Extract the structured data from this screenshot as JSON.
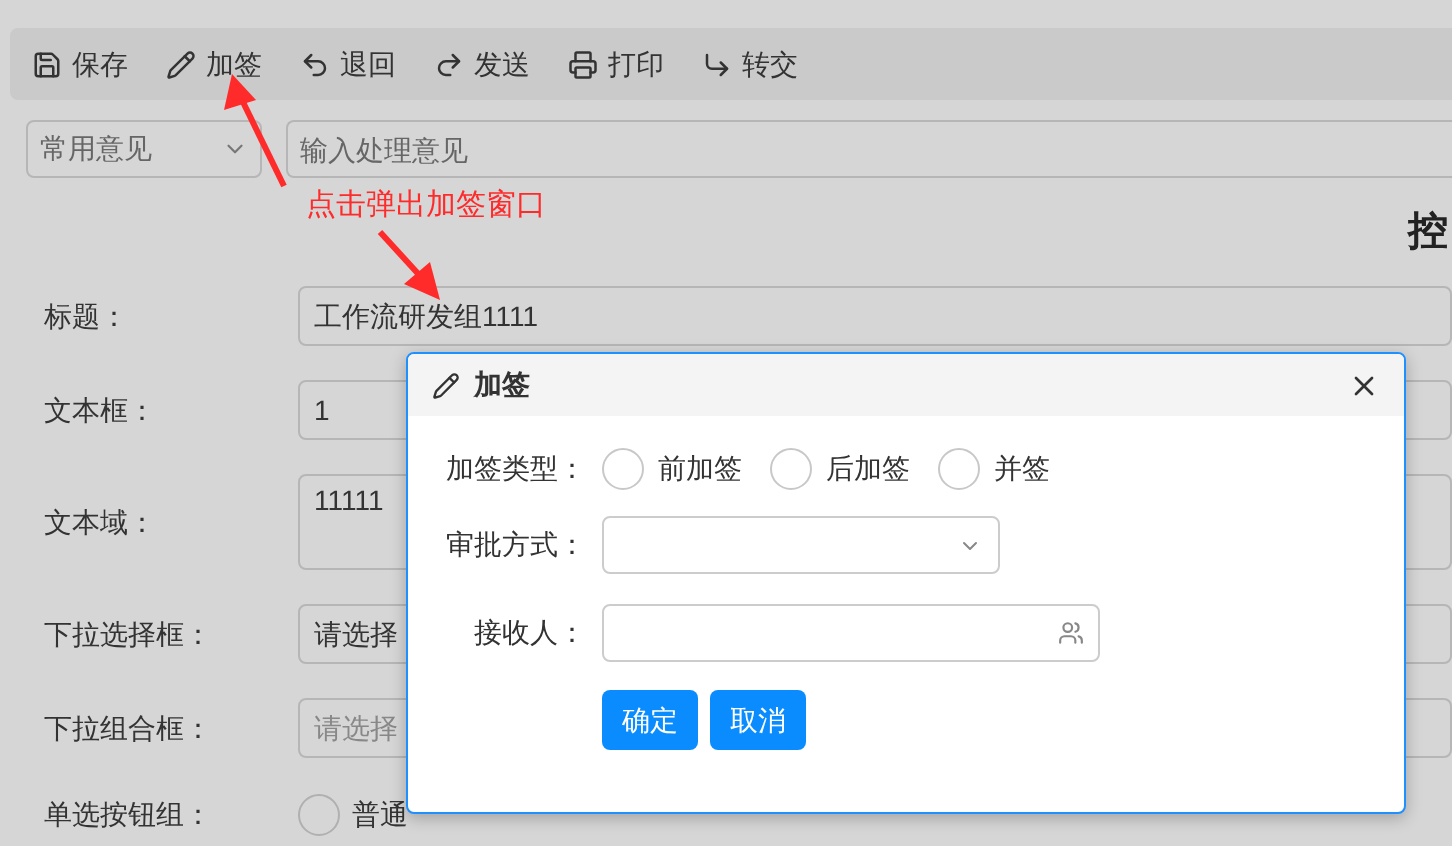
{
  "toolbar": [
    {
      "label": "保存"
    },
    {
      "label": "加签"
    },
    {
      "label": "退回"
    },
    {
      "label": "发送"
    },
    {
      "label": "打印"
    },
    {
      "label": "转交"
    }
  ],
  "opinion": {
    "dropdown": "常用意见",
    "placeholder": "输入处理意见"
  },
  "annotation": "点击弹出加签窗口",
  "form_title": "控",
  "form": {
    "rows": [
      {
        "label": "标题：",
        "kind": "text",
        "value": "工作流研发组1111"
      },
      {
        "label": "文本框：",
        "kind": "text",
        "value": "1"
      },
      {
        "label": "文本域：",
        "kind": "textarea",
        "value": "11111"
      },
      {
        "label": "下拉选择框：",
        "kind": "select",
        "value": "请选择"
      },
      {
        "label": "下拉组合框：",
        "kind": "combo",
        "placeholder": "请选择"
      },
      {
        "label": "单选按钮组：",
        "kind": "radio",
        "options": [
          {
            "label": "普通",
            "selected": false
          }
        ]
      }
    ]
  },
  "dialog": {
    "title": "加签",
    "type_label": "加签类型：",
    "type_options": [
      {
        "label": "前加签",
        "selected": false
      },
      {
        "label": "后加签",
        "selected": false
      },
      {
        "label": "并签",
        "selected": false
      }
    ],
    "method_label": "审批方式：",
    "receiver_label": "接收人：",
    "buttons": [
      "确定",
      "取消"
    ]
  }
}
